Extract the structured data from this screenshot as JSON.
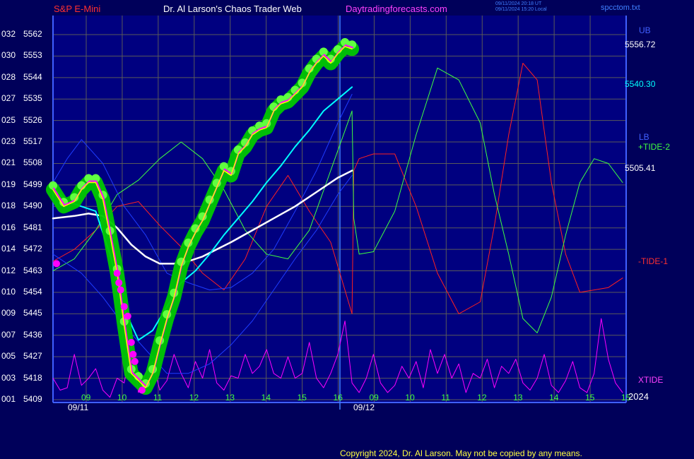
{
  "header": {
    "symbol": "S&P E-Mini",
    "title": "Dr. Al Larson's Chaos Trader Web",
    "site": "Daytradingforecasts.com",
    "time_utc": "09/11/2024 20:18 UT",
    "time_local": "09/11/2024 15:20 Local",
    "filename": "spcctom.txt"
  },
  "copyright": "Copyright 2024, Dr. Al Larson. May not be copied by any means.",
  "colors": {
    "background": "#00005a",
    "plot": "#000080",
    "grid": "#5a5a5a",
    "price": "#ffff00",
    "price_glow": "#00c800",
    "magenta": "#ff00ff",
    "cyan": "#00ffff",
    "white": "#ffffff",
    "blue": "#1e3cff",
    "tide1": "#ff2020",
    "tide2": "#40ff40"
  },
  "chart_data": {
    "type": "line",
    "title": "S&P E-Mini",
    "y_left_labels": [
      "032",
      "030",
      "028",
      "027",
      "025",
      "023",
      "021",
      "019",
      "018",
      "016",
      "014",
      "012",
      "010",
      "009",
      "007",
      "005",
      "003",
      "001"
    ],
    "y_price_labels": [
      "5562",
      "5553",
      "5544",
      "5535",
      "5526",
      "5517",
      "5508",
      "5499",
      "5490",
      "5481",
      "5472",
      "5463",
      "5454",
      "5445",
      "5436",
      "5427",
      "5418",
      "5409"
    ],
    "ylim": [
      5409,
      5562
    ],
    "x_tick_labels": [
      "09",
      "10",
      "11",
      "12",
      "13",
      "14",
      "15",
      "16",
      "09",
      "10",
      "11",
      "12",
      "13",
      "14",
      "15",
      "15"
    ],
    "date_labels": [
      "09/11",
      "09/12"
    ],
    "year_label": "2024",
    "right_labels": {
      "ub": "UB",
      "ub_value": "5556.72",
      "cyan_value": "5540.30",
      "lb": "LB",
      "tide2": "+TIDE-2",
      "white_value": "5505.41",
      "tide1": "-TIDE-1",
      "xtide": "XTIDE"
    },
    "series": [
      {
        "name": "S&P E-Mini",
        "x": [
          0,
          3,
          6,
          8,
          10,
          12,
          14,
          16,
          18,
          20,
          22,
          24,
          26,
          28,
          30,
          32,
          34,
          36,
          38,
          40,
          42,
          44,
          46,
          48,
          50,
          52,
          54,
          56,
          58,
          60,
          62,
          64,
          66,
          68,
          70,
          72,
          74,
          76,
          78,
          80,
          82,
          84
        ],
        "values": [
          5497,
          5490,
          5492,
          5497,
          5500,
          5500,
          5493,
          5478,
          5462,
          5440,
          5420,
          5417,
          5414,
          5420,
          5432,
          5443,
          5452,
          5465,
          5473,
          5479,
          5484,
          5491,
          5498,
          5505,
          5503,
          5512,
          5515,
          5520,
          5522,
          5523,
          5530,
          5533,
          5534,
          5537,
          5540,
          5546,
          5550,
          5553,
          5550,
          5554,
          5557,
          5556
        ]
      },
      {
        "name": "cyan",
        "x": [
          0,
          4,
          8,
          12,
          16,
          20,
          24,
          28,
          32,
          36,
          40,
          44,
          48,
          52,
          56,
          60,
          64,
          68,
          72,
          76,
          80,
          84
        ],
        "values": [
          5498,
          5492,
          5490,
          5488,
          5470,
          5447,
          5434,
          5438,
          5448,
          5458,
          5463,
          5470,
          5478,
          5485,
          5492,
          5500,
          5507,
          5515,
          5522,
          5530,
          5535,
          5540
        ]
      },
      {
        "name": "white",
        "x": [
          0,
          6,
          10,
          14,
          18,
          22,
          26,
          30,
          34,
          38,
          42,
          46,
          50,
          56,
          62,
          68,
          74,
          80,
          84
        ],
        "values": [
          5485,
          5486,
          5487,
          5486,
          5481,
          5474,
          5469,
          5466,
          5466,
          5467,
          5469,
          5472,
          5475,
          5480,
          5485,
          5490,
          5496,
          5502,
          5505
        ]
      },
      {
        "name": "UB",
        "x": [
          0,
          4,
          8,
          14,
          20,
          26,
          32,
          38,
          44,
          50,
          56,
          62,
          68,
          74,
          80,
          84
        ],
        "values": [
          5500,
          5510,
          5518,
          5508,
          5490,
          5478,
          5462,
          5458,
          5455,
          5456,
          5462,
          5472,
          5488,
          5505,
          5525,
          5537
        ]
      },
      {
        "name": "LB",
        "x": [
          0,
          4,
          8,
          14,
          20,
          26,
          32,
          38,
          44,
          50,
          56,
          62,
          68,
          74,
          80,
          84
        ],
        "values": [
          5470,
          5466,
          5462,
          5452,
          5440,
          5430,
          5420,
          5420,
          5424,
          5432,
          5442,
          5455,
          5468,
          5480,
          5495,
          5503
        ]
      },
      {
        "name": "+TIDE-2",
        "x": [
          0,
          6,
          12,
          18,
          24,
          30,
          36,
          42,
          48,
          54,
          60,
          66,
          72,
          78,
          84,
          84.5,
          86,
          90,
          96,
          102,
          108,
          114,
          120,
          124,
          128,
          132,
          136,
          140,
          144,
          148,
          152,
          156,
          160
        ],
        "values": [
          5463,
          5468,
          5480,
          5495,
          5501,
          5510,
          5517,
          5510,
          5497,
          5480,
          5470,
          5468,
          5480,
          5505,
          5530,
          5485,
          5470,
          5471,
          5488,
          5520,
          5548,
          5543,
          5525,
          5495,
          5470,
          5443,
          5437,
          5452,
          5478,
          5500,
          5510,
          5508,
          5500
        ]
      },
      {
        "name": "-TIDE-1",
        "x": [
          0,
          6,
          12,
          18,
          24,
          30,
          36,
          42,
          48,
          54,
          60,
          66,
          72,
          78,
          84,
          84.5,
          86,
          90,
          96,
          102,
          108,
          114,
          120,
          124,
          128,
          132,
          136,
          140,
          144,
          148,
          152,
          156,
          160
        ],
        "values": [
          5467,
          5472,
          5480,
          5490,
          5492,
          5482,
          5473,
          5462,
          5455,
          5468,
          5490,
          5503,
          5488,
          5475,
          5445,
          5505,
          5510,
          5512,
          5512,
          5490,
          5462,
          5445,
          5450,
          5482,
          5520,
          5550,
          5543,
          5500,
          5470,
          5454,
          5455,
          5456,
          5460
        ]
      },
      {
        "name": "XTIDE",
        "x": [
          0,
          2,
          4,
          6,
          8,
          10,
          12,
          14,
          16,
          18,
          20,
          22,
          24,
          26,
          28,
          30,
          32,
          34,
          36,
          38,
          40,
          42,
          44,
          46,
          48,
          50,
          52,
          54,
          56,
          58,
          60,
          62,
          64,
          66,
          68,
          70,
          72,
          74,
          76,
          78,
          80,
          82,
          84,
          86,
          88,
          90,
          92,
          94,
          96,
          98,
          100,
          102,
          104,
          106,
          108,
          110,
          112,
          114,
          116,
          118,
          120,
          122,
          124,
          126,
          128,
          130,
          132,
          134,
          136,
          138,
          140,
          142,
          144,
          146,
          148,
          150,
          152,
          154,
          156,
          158,
          160
        ],
        "values": [
          5418,
          5413,
          5414,
          5428,
          5415,
          5418,
          5422,
          5413,
          5410,
          5418,
          5416,
          5432,
          5412,
          5420,
          5425,
          5413,
          5417,
          5428,
          5420,
          5414,
          5425,
          5418,
          5430,
          5416,
          5413,
          5419,
          5418,
          5428,
          5420,
          5423,
          5430,
          5420,
          5418,
          5427,
          5418,
          5420,
          5433,
          5418,
          5414,
          5420,
          5428,
          5442,
          5416,
          5412,
          5418,
          5428,
          5416,
          5412,
          5415,
          5423,
          5418,
          5425,
          5414,
          5430,
          5420,
          5428,
          5418,
          5424,
          5412,
          5420,
          5418,
          5426,
          5414,
          5423,
          5420,
          5426,
          5416,
          5413,
          5418,
          5428,
          5415,
          5412,
          5417,
          5425,
          5414,
          5412,
          5420,
          5443,
          5426,
          5416,
          5412
        ]
      }
    ],
    "marker_points": {
      "name": "magenta dots",
      "x": [
        1,
        18,
        18.5,
        19,
        20,
        21,
        22,
        22.5,
        23,
        25
      ],
      "values": [
        5466,
        5462,
        5458,
        5455,
        5448,
        5444,
        5433,
        5428,
        5425,
        5413
      ]
    }
  }
}
